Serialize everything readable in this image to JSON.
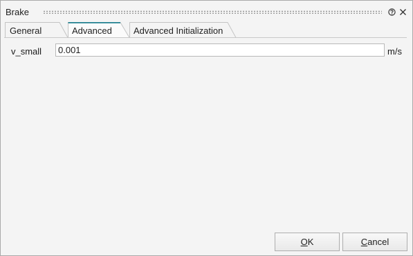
{
  "window": {
    "title": "Brake"
  },
  "tabs": [
    {
      "label": "General",
      "active": false
    },
    {
      "label": "Advanced",
      "active": true
    },
    {
      "label": "Advanced Initialization",
      "active": false
    }
  ],
  "fields": [
    {
      "label": "v_small",
      "value": "0.001",
      "unit": "m/s"
    }
  ],
  "buttons": {
    "ok": {
      "mnemonic": "O",
      "rest": "K"
    },
    "cancel": {
      "mnemonic": "C",
      "rest": "ancel"
    }
  },
  "colors": {
    "active_tab_accent": "#1f7f8f",
    "background": "#f4f4f4"
  },
  "icons": {
    "help": "help-icon",
    "close": "close-icon"
  }
}
